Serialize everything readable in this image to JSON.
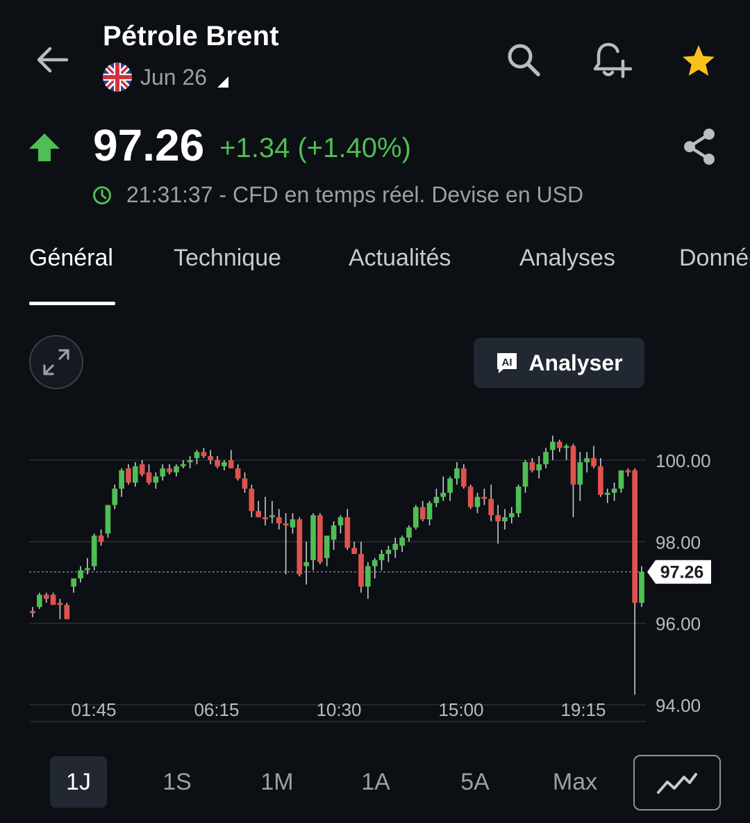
{
  "header": {
    "title": "Pétrole Brent",
    "contract": "Jun 26"
  },
  "quote": {
    "price": "97.26",
    "change": "+1.34 (+1.40%)",
    "time": "21:31:37",
    "separator": " - ",
    "info": "CFD en temps réel. Devise en USD"
  },
  "tabs": [
    {
      "label": "Général"
    },
    {
      "label": "Technique"
    },
    {
      "label": "Actualités"
    },
    {
      "label": "Analyses"
    },
    {
      "label": "Données"
    }
  ],
  "analyser": {
    "label": "Analyser",
    "badge": "AI"
  },
  "ranges": [
    {
      "label": "1J"
    },
    {
      "label": "1S"
    },
    {
      "label": "1M"
    },
    {
      "label": "1A"
    },
    {
      "label": "5A"
    },
    {
      "label": "Max"
    }
  ],
  "colors": {
    "up": "#4fbe54",
    "down": "#e0524d",
    "star": "#f8c21b",
    "gridline": "#2b3038"
  },
  "chart_data": {
    "type": "candlestick",
    "ylim": [
      94,
      100.6
    ],
    "y_ticks": [
      "100.00",
      "98.00",
      "96.00",
      "94.00"
    ],
    "y_tick_values": [
      100,
      98,
      96,
      94
    ],
    "x_ticks": [
      "01:45",
      "06:15",
      "10:30",
      "15:00",
      "19:15"
    ],
    "last_price_label": "97.26",
    "last_price": 97.26,
    "grid": true,
    "candles": [
      [
        96.3,
        96.4,
        96.15,
        96.25
      ],
      [
        96.4,
        96.75,
        96.35,
        96.7
      ],
      [
        96.7,
        96.75,
        96.5,
        96.6
      ],
      [
        96.7,
        96.75,
        96.45,
        96.45
      ],
      [
        96.5,
        96.6,
        96.1,
        96.45
      ],
      [
        96.45,
        96.5,
        96.1,
        96.1
      ],
      [
        96.9,
        97.1,
        96.75,
        97.1
      ],
      [
        97.1,
        97.4,
        97.0,
        97.3
      ],
      [
        97.3,
        97.6,
        97.2,
        97.35
      ],
      [
        97.4,
        98.2,
        97.3,
        98.15
      ],
      [
        98.15,
        98.3,
        97.9,
        98.0
      ],
      [
        98.2,
        98.9,
        98.1,
        98.9
      ],
      [
        98.9,
        99.4,
        98.8,
        99.3
      ],
      [
        99.3,
        99.8,
        99.1,
        99.75
      ],
      [
        99.8,
        99.9,
        99.4,
        99.45
      ],
      [
        99.45,
        99.95,
        99.35,
        99.85
      ],
      [
        99.9,
        100.0,
        99.6,
        99.65
      ],
      [
        99.7,
        99.9,
        99.4,
        99.45
      ],
      [
        99.45,
        99.7,
        99.3,
        99.6
      ],
      [
        99.6,
        99.9,
        99.5,
        99.8
      ],
      [
        99.8,
        99.9,
        99.65,
        99.7
      ],
      [
        99.7,
        99.9,
        99.6,
        99.85
      ],
      [
        99.85,
        100.0,
        99.8,
        99.9
      ],
      [
        99.95,
        100.1,
        99.8,
        100.0
      ],
      [
        100.05,
        100.25,
        99.9,
        100.2
      ],
      [
        100.2,
        100.3,
        100.05,
        100.1
      ],
      [
        100.1,
        100.25,
        99.9,
        100.0
      ],
      [
        100.0,
        100.1,
        99.8,
        99.85
      ],
      [
        99.85,
        100.0,
        99.75,
        99.95
      ],
      [
        100.0,
        100.25,
        99.85,
        99.8
      ],
      [
        99.8,
        99.9,
        99.5,
        99.55
      ],
      [
        99.55,
        99.7,
        99.2,
        99.3
      ],
      [
        99.3,
        99.4,
        98.6,
        98.75
      ],
      [
        98.75,
        99.0,
        98.6,
        98.6
      ],
      [
        98.6,
        99.1,
        98.4,
        98.55
      ],
      [
        98.6,
        99.0,
        98.45,
        98.65
      ],
      [
        98.6,
        98.8,
        98.3,
        98.45
      ],
      [
        98.45,
        98.7,
        97.2,
        98.4
      ],
      [
        98.35,
        98.7,
        98.2,
        98.55
      ],
      [
        98.55,
        98.6,
        97.15,
        97.2
      ],
      [
        97.4,
        98.0,
        96.95,
        97.5
      ],
      [
        97.55,
        98.7,
        97.3,
        98.65
      ],
      [
        98.65,
        98.7,
        97.45,
        97.5
      ],
      [
        97.6,
        98.1,
        97.4,
        98.15
      ],
      [
        98.05,
        98.5,
        97.8,
        98.4
      ],
      [
        98.4,
        98.65,
        98.2,
        98.6
      ],
      [
        98.6,
        98.8,
        97.8,
        97.85
      ],
      [
        97.85,
        98.0,
        97.7,
        97.7
      ],
      [
        97.7,
        98.0,
        96.75,
        96.9
      ],
      [
        96.9,
        97.5,
        96.6,
        97.4
      ],
      [
        97.4,
        97.6,
        97.1,
        97.55
      ],
      [
        97.55,
        97.8,
        97.3,
        97.7
      ],
      [
        97.7,
        97.9,
        97.5,
        97.8
      ],
      [
        97.8,
        98.1,
        97.6,
        97.95
      ],
      [
        97.9,
        98.15,
        97.75,
        98.1
      ],
      [
        98.1,
        98.4,
        98.0,
        98.35
      ],
      [
        98.35,
        98.9,
        98.3,
        98.85
      ],
      [
        98.85,
        99.0,
        98.5,
        98.55
      ],
      [
        98.55,
        99.0,
        98.4,
        98.95
      ],
      [
        98.95,
        99.3,
        98.85,
        99.1
      ],
      [
        99.1,
        99.6,
        99.0,
        99.2
      ],
      [
        99.2,
        99.6,
        99.0,
        99.55
      ],
      [
        99.55,
        99.95,
        99.4,
        99.8
      ],
      [
        99.8,
        99.9,
        99.3,
        99.35
      ],
      [
        99.35,
        99.4,
        98.8,
        98.85
      ],
      [
        98.85,
        99.2,
        98.7,
        99.1
      ],
      [
        99.1,
        99.3,
        98.9,
        99.05
      ],
      [
        99.05,
        99.4,
        98.5,
        98.65
      ],
      [
        98.65,
        98.9,
        97.95,
        98.5
      ],
      [
        98.5,
        98.8,
        98.3,
        98.6
      ],
      [
        98.6,
        98.85,
        98.45,
        98.7
      ],
      [
        98.7,
        99.4,
        98.6,
        99.35
      ],
      [
        99.35,
        100.0,
        99.2,
        99.95
      ],
      [
        99.95,
        100.05,
        99.7,
        99.75
      ],
      [
        99.75,
        100.1,
        99.55,
        99.9
      ],
      [
        99.9,
        100.3,
        99.8,
        100.2
      ],
      [
        100.25,
        100.6,
        100.0,
        100.45
      ],
      [
        100.45,
        100.5,
        100.2,
        100.3
      ],
      [
        100.3,
        100.4,
        100.0,
        100.35
      ],
      [
        100.35,
        100.4,
        98.6,
        99.4
      ],
      [
        99.4,
        100.2,
        99.0,
        99.95
      ],
      [
        99.95,
        100.2,
        99.7,
        100.05
      ],
      [
        100.05,
        100.35,
        99.8,
        99.85
      ],
      [
        99.85,
        100.05,
        99.1,
        99.15
      ],
      [
        99.15,
        99.3,
        98.95,
        99.2
      ],
      [
        99.2,
        99.45,
        99.0,
        99.3
      ],
      [
        99.3,
        99.75,
        99.2,
        99.75
      ],
      [
        99.75,
        99.8,
        99.6,
        99.7
      ],
      [
        99.75,
        99.8,
        94.25,
        96.5
      ],
      [
        96.5,
        97.4,
        96.4,
        97.26
      ]
    ]
  }
}
